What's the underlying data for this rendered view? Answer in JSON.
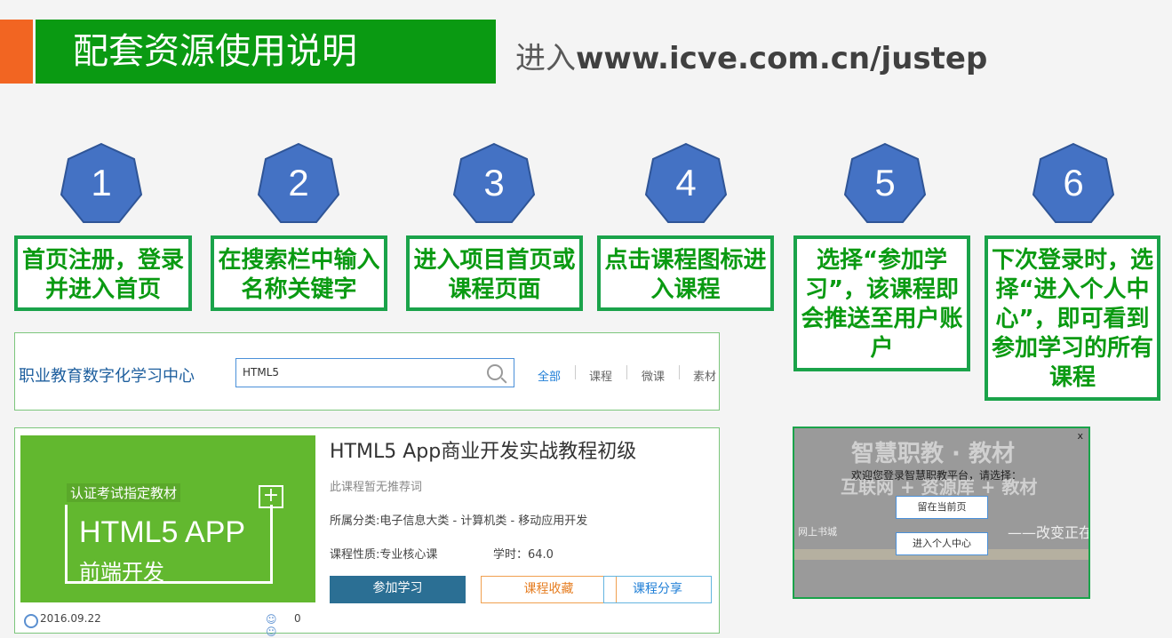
{
  "header": {
    "title": "配套资源使用说明",
    "subtitle_prefix": "进入",
    "subtitle_url": "www.icve.com.cn/justep"
  },
  "colors": {
    "accent_green": "#0a9a12",
    "orange": "#f26522",
    "heptagon": "#4472c4",
    "box_border": "#1aa34a"
  },
  "steps": [
    {
      "num": "1",
      "text": "首页注册，登录并进入首页"
    },
    {
      "num": "2",
      "text": "在搜索栏中输入名称关键字"
    },
    {
      "num": "3",
      "text": "进入项目首页或课程页面"
    },
    {
      "num": "4",
      "text": "点击课程图标进入课程"
    },
    {
      "num": "5",
      "text": "选择“参加学习”，该课程即会推送至用户账户"
    },
    {
      "num": "6",
      "text": "下次登录时，选择“进入个人中心”，即可看到参加学习的所有课程"
    }
  ],
  "search_panel": {
    "platform_name": "职业教育数字化学习中心",
    "search_value": "HTML5",
    "nav": [
      "全部",
      "课程",
      "微课",
      "素材"
    ]
  },
  "course": {
    "cover_badge": "认证考试指定教材",
    "cover_big": "HTML5 APP",
    "cover_small": "前端开发",
    "title": "HTML5 App商业开发实战教程初级",
    "recommend": "此课程暂无推荐词",
    "category": "所属分类:电子信息大类 - 计算机类 - 移动应用开发",
    "nature": "课程性质:专业核心课",
    "hours": "学时：64.0",
    "btn_join": "参加学习",
    "btn_fav": "课程收藏",
    "btn_share": "课程分享",
    "date": "2016.09.22",
    "people": "0"
  },
  "modal": {
    "bg_title": "智慧职教 · 教材",
    "bg_sub": "互联网 + 资源库 + 教材",
    "bg_left": "网上书城",
    "bg_right": "——改变正在",
    "welcome": "欢迎您登录智慧职教平台，请选择：",
    "close": "x",
    "btn_stay": "留在当前页",
    "btn_center": "进入个人中心"
  }
}
